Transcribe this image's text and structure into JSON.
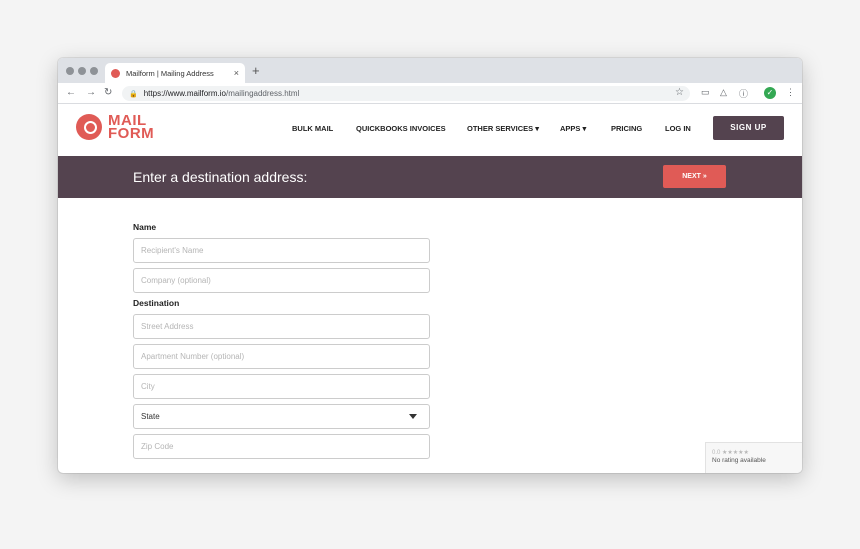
{
  "browser": {
    "tab_title": "Mailform | Mailing Address",
    "tab_close": "×",
    "new_tab": "+",
    "url_host": "https://www.mailform.io",
    "url_path": "/mailingaddress.html"
  },
  "site": {
    "logo_line1": "MAIL",
    "logo_line2": "FORM",
    "brand_color": "#e05b56",
    "nav": [
      "BULK MAIL",
      "QUICKBOOKS INVOICES",
      "OTHER SERVICES ▾",
      "APPS ▾",
      "PRICING",
      "LOG IN"
    ],
    "signup": "SIGN UP"
  },
  "banner": {
    "title": "Enter a destination address:",
    "next": "NEXT »",
    "color": "#54434f"
  },
  "form": {
    "name_label": "Name",
    "recipient_placeholder": "Recipient's Name",
    "company_placeholder": "Company (optional)",
    "destination_label": "Destination",
    "street_placeholder": "Street Address",
    "apartment_placeholder": "Apartment Number (optional)",
    "city_placeholder": "City",
    "state_value": "State",
    "zip_placeholder": "Zip Code"
  },
  "rating": {
    "score": "0.0 ★★★★★",
    "text": "No rating available"
  }
}
